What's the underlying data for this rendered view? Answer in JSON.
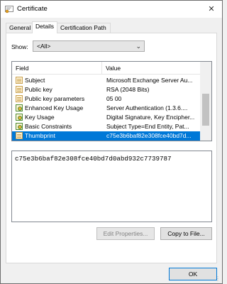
{
  "window": {
    "title": "Certificate",
    "close_glyph": "✕",
    "app_icon": "certificate-icon"
  },
  "tabs": [
    {
      "label": "General",
      "active": false
    },
    {
      "label": "Details",
      "active": true
    },
    {
      "label": "Certification Path",
      "active": false
    }
  ],
  "show": {
    "label": "Show:",
    "value": "<All>"
  },
  "list": {
    "columns": [
      "Field",
      "Value"
    ],
    "rows": [
      {
        "field": "Subject",
        "value": "Microsoft Exchange Server Au...",
        "icon": "document-icon"
      },
      {
        "field": "Public key",
        "value": "RSA (2048 Bits)",
        "icon": "document-icon"
      },
      {
        "field": "Public key parameters",
        "value": "05 00",
        "icon": "document-icon"
      },
      {
        "field": "Enhanced Key Usage",
        "value": "Server Authentication (1.3.6....",
        "icon": "extension-icon"
      },
      {
        "field": "Key Usage",
        "value": "Digital Signature, Key Encipher...",
        "icon": "extension-icon"
      },
      {
        "field": "Basic Constraints",
        "value": "Subject Type=End Entity, Pat...",
        "icon": "extension-icon"
      },
      {
        "field": "Thumbprint",
        "value": "c75e3b6baf82e308fce40bd7d...",
        "icon": "document-icon",
        "selected": true
      }
    ]
  },
  "value_text": "c75e3b6baf82e308fce40bd7d0abd932c7739787",
  "buttons": {
    "edit": "Edit Properties...",
    "copy": "Copy to File...",
    "ok": "OK"
  },
  "colors": {
    "selection": "#0078d7"
  }
}
